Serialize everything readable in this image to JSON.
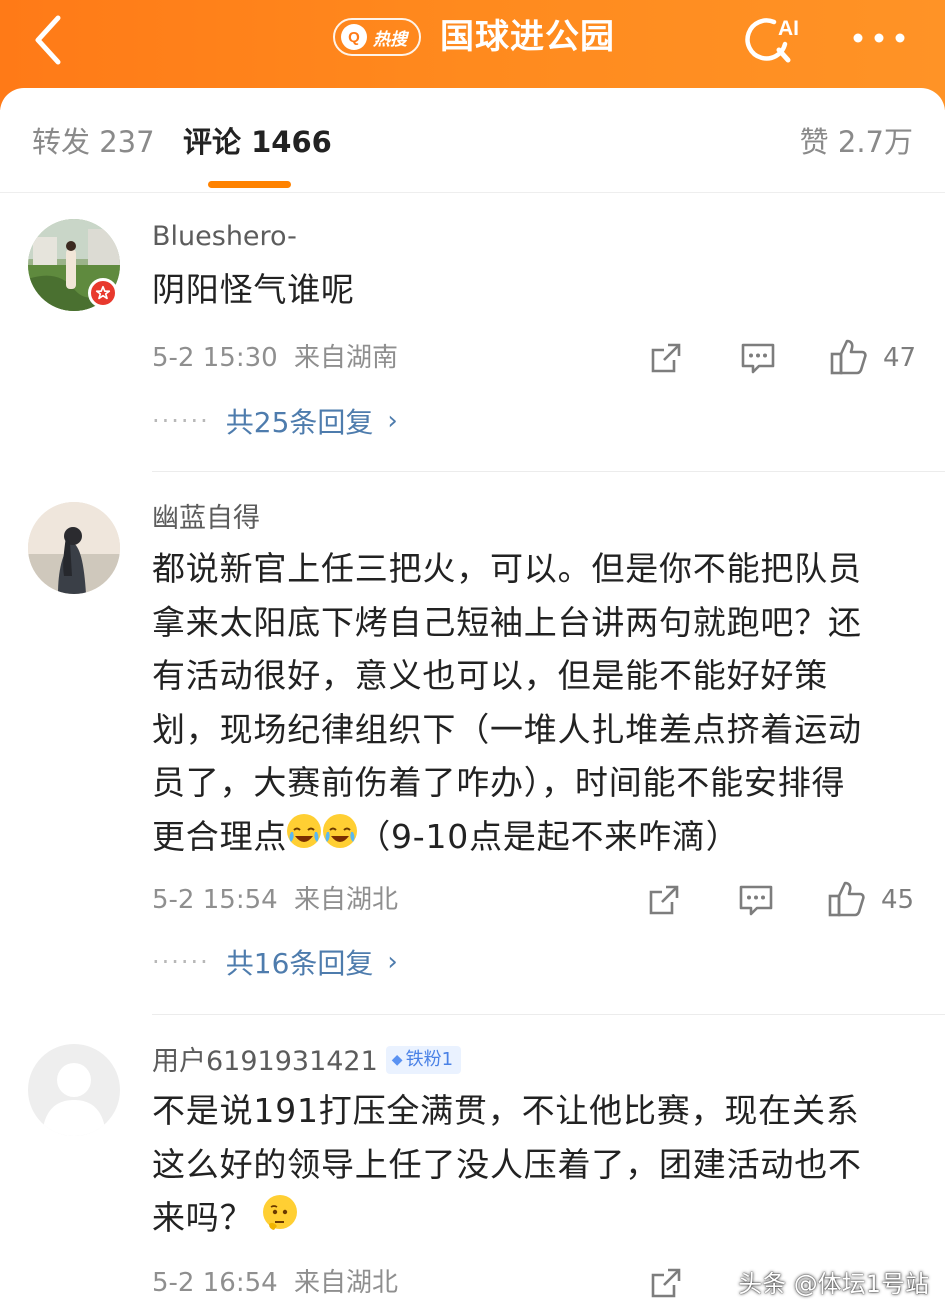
{
  "header": {
    "hot_search_icon": "Q",
    "hot_search_label": "热搜",
    "topic_title": "国球进公园",
    "ai_label": "AI"
  },
  "tabs": {
    "reposts": "转发 237",
    "comments": "评论 1466",
    "likes": "赞 2.7万"
  },
  "comments": [
    {
      "username": "Blueshero-",
      "text": "阴阳怪气谁呢",
      "time": "5-2 15:30",
      "location": "来自湖南",
      "likes": "47",
      "replies_label": "共25条回复",
      "verified": true
    },
    {
      "username": "幽蓝自得",
      "text_lines": [
        "都说新官上任三把火，可以。但是你不能把队员",
        "拿来太阳底下烤自己短袖上台讲两句就跑吧？还",
        "有活动很好，意义也可以，但是能不能好好策",
        "划，现场纪律组织下（一堆人扎堆差点挤着运动",
        "员了，大赛前伤着了咋办），时间能不能安排得"
      ],
      "text_last_start": "更合理点",
      "text_last_end": "（9-10点是起不来咋滴）",
      "time": "5-2 15:54",
      "location": "来自湖北",
      "likes": "45",
      "replies_label": "共16条回复"
    },
    {
      "username": "用户6191931421",
      "fan_badge": "铁粉1",
      "text_lines": [
        "不是说191打压全满贯，不让他比赛，现在关系",
        "这么好的领导上任了没人压着了，团建活动也不"
      ],
      "text_last_start": "来吗？",
      "time": "5-2 16:54",
      "location": "来自湖北"
    }
  ],
  "icons": {
    "back": "chevron-left",
    "ai_search": "ai-search",
    "more": "ellipsis",
    "share": "share-box-arrow",
    "comment": "speech-bubble",
    "like": "thumbs-up",
    "emoji_cry_laugh": "tears-of-joy",
    "emoji_thinking": "thinking-face"
  },
  "colors": {
    "header_orange": "#ff7a17",
    "tab_indicator": "#ff8200",
    "reply_link": "#4e7cad",
    "fan_badge_bg": "#eaf2ff"
  },
  "watermark": "头条 @体坛1号站"
}
